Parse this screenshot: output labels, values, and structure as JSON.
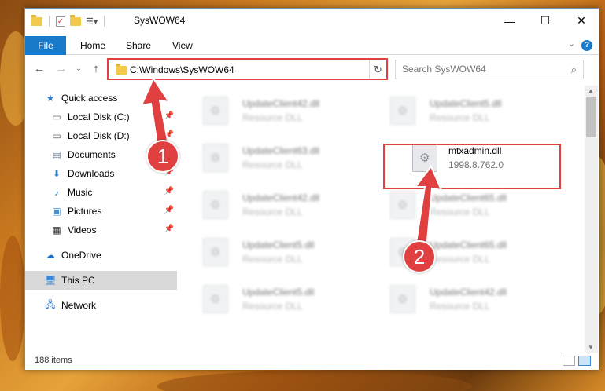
{
  "window": {
    "title": "SysWOW64"
  },
  "ribbon": {
    "tabs": [
      "File",
      "Home",
      "Share",
      "View"
    ],
    "help": "?"
  },
  "address": {
    "path": "C:\\Windows\\SysWOW64"
  },
  "search": {
    "placeholder": "Search SysWOW64"
  },
  "sidebar": {
    "items": [
      {
        "label": "Quick access",
        "icon": "star-icon"
      },
      {
        "label": "Local Disk (C:)",
        "icon": "drive-icon",
        "pinned": true
      },
      {
        "label": "Local Disk (D:)",
        "icon": "drive-icon",
        "pinned": true
      },
      {
        "label": "Documents",
        "icon": "documents-icon",
        "pinned": true
      },
      {
        "label": "Downloads",
        "icon": "download-icon",
        "pinned": true
      },
      {
        "label": "Music",
        "icon": "music-icon",
        "pinned": true
      },
      {
        "label": "Pictures",
        "icon": "pictures-icon",
        "pinned": true
      },
      {
        "label": "Videos",
        "icon": "videos-icon",
        "pinned": true
      },
      {
        "label": "OneDrive",
        "icon": "cloud-icon"
      },
      {
        "label": "This PC",
        "icon": "computer-icon",
        "selected": true
      },
      {
        "label": "Network",
        "icon": "network-icon"
      }
    ]
  },
  "files": [
    {
      "name": "UpdateClient42.dll",
      "type": "Resource DLL",
      "blurred": true
    },
    {
      "name": "UpdateClient5.dll",
      "type": "Resource DLL",
      "blurred": true
    },
    {
      "name": "UpdateClient63.dll",
      "type": "Resource DLL",
      "blurred": true
    },
    {
      "name": "mtxadmin.dll",
      "type": "1998.8.762.0",
      "blurred": false
    },
    {
      "name": "UpdateClient42.dll",
      "type": "Resource DLL",
      "blurred": true
    },
    {
      "name": "UpdateClient65.dll",
      "type": "Resource DLL",
      "blurred": true
    },
    {
      "name": "UpdateClient5.dll",
      "type": "Resource DLL",
      "blurred": true
    },
    {
      "name": "UpdateClient65.dll",
      "type": "Resource DLL",
      "blurred": true
    },
    {
      "name": "UpdateClient5.dll",
      "type": "Resource DLL",
      "blurred": true
    },
    {
      "name": "UpdateClient42.dll",
      "type": "Resource DLL",
      "blurred": true
    }
  ],
  "status": {
    "item_count": "188 items"
  },
  "annotations": {
    "step1": "1",
    "step2": "2"
  },
  "colors": {
    "accent": "#1979ca",
    "highlight": "#e04040"
  }
}
